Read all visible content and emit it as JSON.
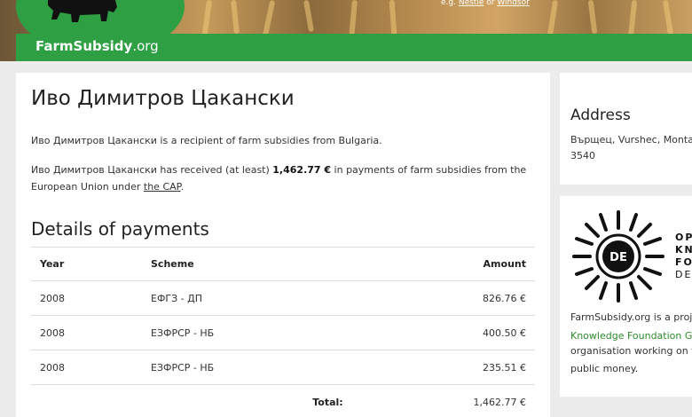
{
  "header": {
    "brand_bold": "FarmSubsidy",
    "brand_suffix": ".org",
    "search_hint_prefix": "e.g. ",
    "search_hint_link1": "Nestlé",
    "search_hint_or": " or ",
    "search_hint_link2": "Windsor"
  },
  "recipient": {
    "name": "Иво Димитров Цакански",
    "intro": "Иво Димитров Цакански is a recipient of farm subsidies from Bulgaria.",
    "received_prefix": "Иво Димитров Цакански has received (at least) ",
    "received_amount": "1,462.77 €",
    "received_suffix": " in payments of farm subsidies from the",
    "received_line2_prefix": "European Union under ",
    "cap_link": "the CAP",
    "received_line2_suffix": "."
  },
  "payments": {
    "title": "Details of payments",
    "headers": {
      "year": "Year",
      "scheme": "Scheme",
      "amount": "Amount"
    },
    "rows": [
      {
        "year": "2008",
        "scheme": "ЕФГЗ - ДП",
        "amount": "826.76 €"
      },
      {
        "year": "2008",
        "scheme": "ЕЗФРСР - НБ",
        "amount": "400.50 €"
      },
      {
        "year": "2008",
        "scheme": "ЕЗФРСР - НБ",
        "amount": "235.51 €"
      }
    ],
    "total_label": "Total:",
    "total_amount": "1,462.77 €"
  },
  "address": {
    "title": "Address",
    "line1": "Върщец, Vurshec, Monta",
    "line2": "3540"
  },
  "okf": {
    "badge": "DE",
    "letters_line1": "OP",
    "letters_line2": "KN",
    "letters_line3": "FO",
    "letters_line4": "DE",
    "text_line1": "FarmSubsidy.org is a proj",
    "link": "Knowledge Foundation G",
    "text_line3": "organisation working on t",
    "text_line4": "public money."
  },
  "colors": {
    "brand_green": "#2ea043",
    "link_green": "#2e8b2e"
  }
}
